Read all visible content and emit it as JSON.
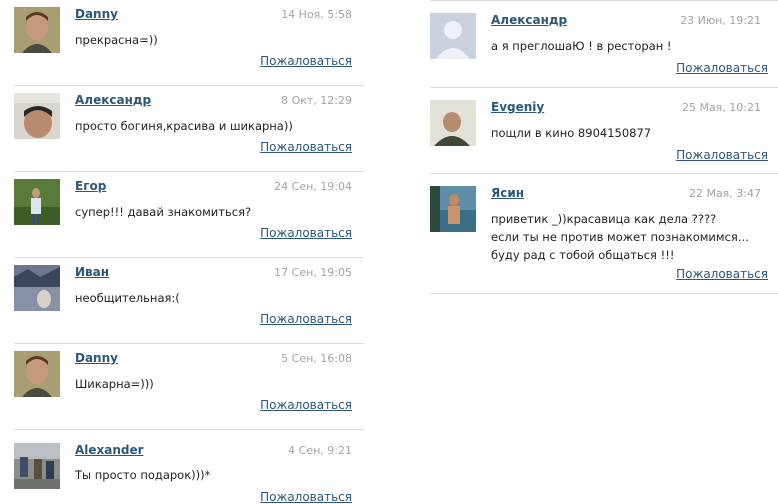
{
  "left_comments": [
    {
      "author": "Danny",
      "date": "14 Ноя, 5:58",
      "text": "прекрасна=))",
      "report": "Пожаловаться",
      "avatar": "photo-avatar"
    },
    {
      "author": "Александр",
      "date": "8 Окт, 12:29",
      "text": "просто богиня,красива и шикарна))",
      "report": "Пожаловаться",
      "avatar": "photo-avatar"
    },
    {
      "author": "Егор",
      "date": "24 Сен, 19:04",
      "text": "супер!!! давай знакомиться?",
      "report": "Пожаловаться",
      "avatar": "photo-avatar"
    },
    {
      "author": "Иван",
      "date": "17 Сен, 19:05",
      "text": "необщительная:(",
      "report": "Пожаловаться",
      "avatar": "photo-avatar"
    },
    {
      "author": "Danny",
      "date": "5 Сен, 16:08",
      "text": "Шикарна=)))",
      "report": "Пожаловаться",
      "avatar": "photo-avatar"
    },
    {
      "author": "Alexander",
      "date": "4 Сен, 9:21",
      "text": "Ты просто подарок)))*",
      "report": "Пожаловаться",
      "avatar": "photo-avatar"
    }
  ],
  "right_comments": [
    {
      "author": "Александр",
      "date": "23 Июн, 19:21",
      "text": "а я преглошаЮ ! в ресторан !",
      "report": "Пожаловаться",
      "avatar": "default-user-avatar"
    },
    {
      "author": "Evgeniy",
      "date": "25 Мая, 10:21",
      "text": "пощли в кино 8904150877",
      "report": "Пожаловаться",
      "avatar": "photo-avatar"
    },
    {
      "author": "Ясин",
      "date": "22 Мая, 3:47",
      "text": "приветик _))красавица как дела ????\nесли ты не против может познакомимся...\nбуду рад с тобой общаться !!!",
      "report": "Пожаловаться",
      "avatar": "photo-avatar"
    }
  ],
  "colors": {
    "link": "#2b587a",
    "date": "#a3a3a3",
    "text": "#222222",
    "divider": "#dcdcdc"
  }
}
